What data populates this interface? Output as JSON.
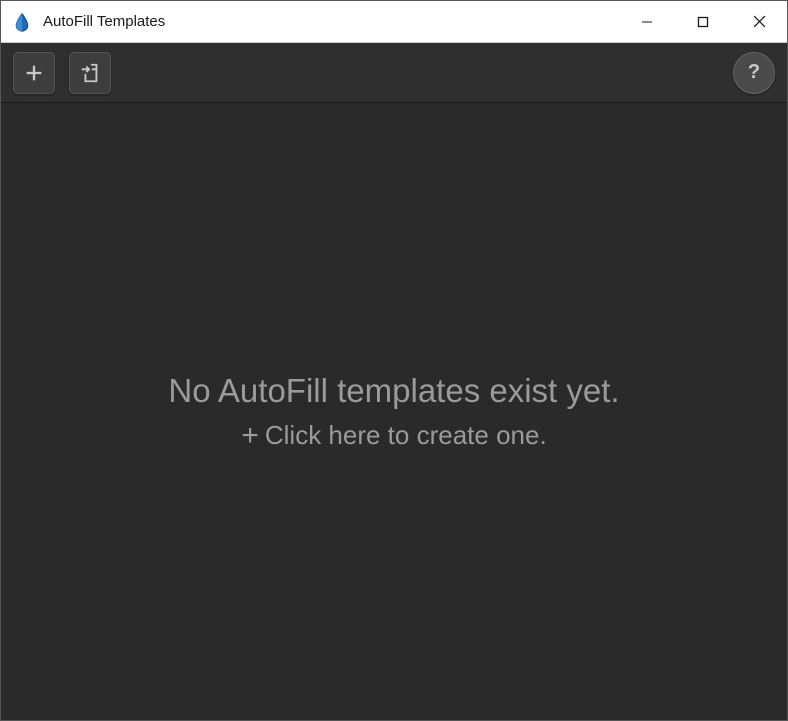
{
  "window": {
    "title": "AutoFill Templates",
    "icon": "droplet-icon"
  },
  "toolbar": {
    "add": {
      "icon": "plus-icon"
    },
    "import": {
      "icon": "import-icon"
    },
    "help": {
      "icon": "help-icon",
      "glyph": "?"
    }
  },
  "content": {
    "empty_title": "No AutoFill templates exist yet.",
    "empty_action": "Click here to create one.",
    "empty_action_icon": "plus-icon"
  }
}
